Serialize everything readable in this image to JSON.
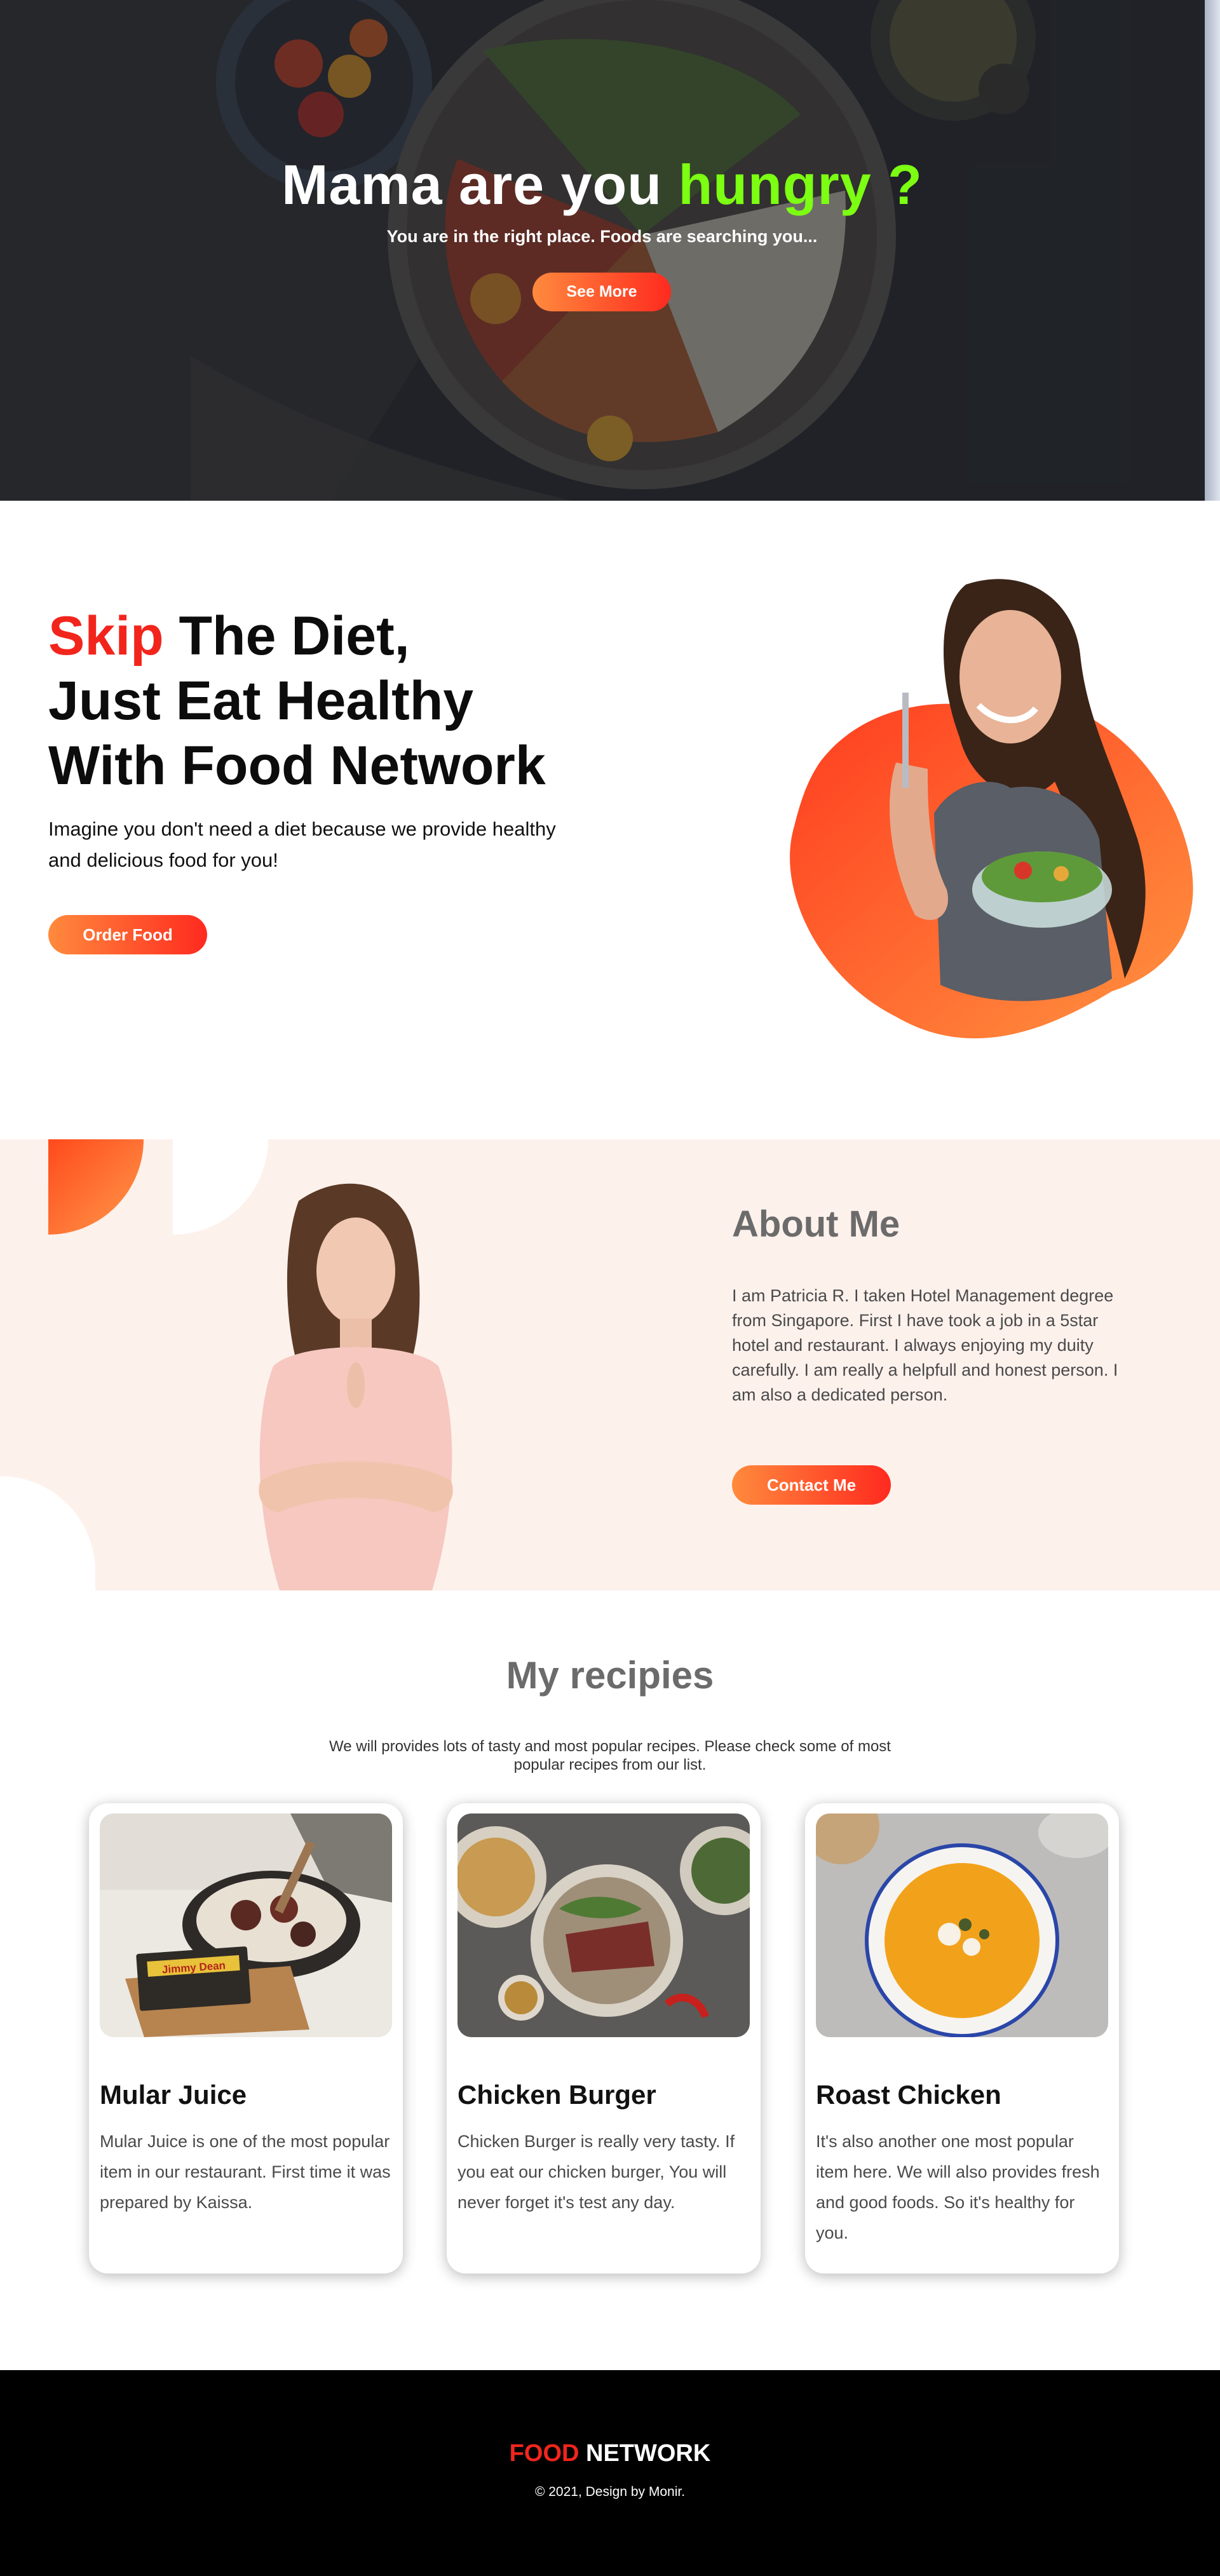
{
  "hero": {
    "title_prefix": "Mama are you ",
    "title_accent": "hungry ?",
    "subtitle": "You are in the right place. Foods are searching you...",
    "button_label": "See More"
  },
  "diet": {
    "title_red": "Skip",
    "title_rest_line1": " The Diet,",
    "title_line2": "Just Eat Healthy",
    "title_line3": "With Food Network",
    "text": "Imagine you don't need a diet because we provide healthy and delicious food for you!",
    "button_label": "Order Food"
  },
  "about": {
    "title": "About Me",
    "text": "I am Patricia R. I taken Hotel Management degree from Singapore. First I have took a job in a 5star hotel and restaurant. I always enjoying my duity carefully. I am really a helpfull and honest person. I am also a dedicated person.",
    "button_label": "Contact Me"
  },
  "recipes": {
    "title": "My recipies",
    "subtitle": "We will provides lots of tasty and most popular recipes. Please check some of most popular recipes from our list.",
    "cards": [
      {
        "title": "Mular Juice",
        "text": "Mular Juice is one of the most popular item in our restaurant. First time it was prepared by Kaissa.",
        "image_label": "Jimmy Dean"
      },
      {
        "title": "Chicken Burger",
        "text": "Chicken Burger is really very tasty. If you eat our chicken burger, You will never forget it's test any day."
      },
      {
        "title": "Roast Chicken",
        "text": "It's also another one most popular item here. We will also provides fresh and good foods. So it's healthy for you."
      }
    ]
  },
  "footer": {
    "brand_red": "FOOD",
    "brand_rest": " NETWORK",
    "copyright": "© 2021, Design by Monir."
  },
  "colors": {
    "accent_green": "#7cff12",
    "brand_red": "#f2251c",
    "button_gradient_start": "#ff8a3d",
    "button_gradient_end": "#ff2a1f",
    "about_bg": "#fdf1ec",
    "footer_bg": "#000000"
  }
}
